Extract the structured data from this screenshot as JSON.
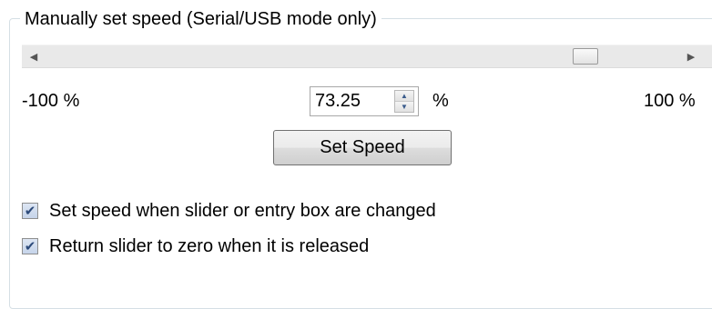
{
  "group": {
    "title": "Manually set speed (Serial/USB mode only)"
  },
  "slider": {
    "min_label": "-100 %",
    "max_label": "100 %",
    "left_arrow": "◀",
    "right_arrow": "▶",
    "value_percent": 73.25
  },
  "speed_input": {
    "value": "73.25",
    "unit": "%",
    "up_glyph": "▲",
    "down_glyph": "▼"
  },
  "set_speed_button": {
    "label": "Set Speed"
  },
  "options": [
    {
      "label": "Set speed when slider or entry box are changed",
      "checked": true,
      "check_glyph": "✔"
    },
    {
      "label": "Return slider to zero when it is released",
      "checked": true,
      "check_glyph": "✔"
    }
  ]
}
